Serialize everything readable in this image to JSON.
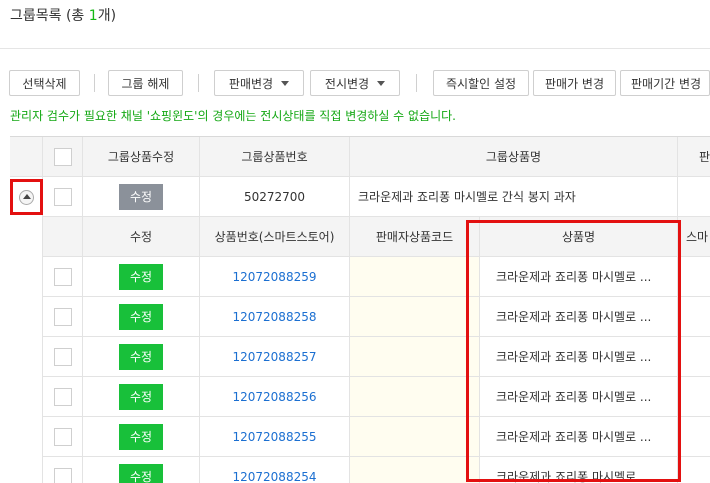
{
  "header": {
    "title_prefix": "그룹목록 (총 ",
    "count": "1",
    "title_suffix": "개)"
  },
  "toolbar": {
    "select_delete": "선택삭제",
    "ungroup": "그룹 해제",
    "sale_change": "판매변경",
    "display_change": "전시변경",
    "instant_discount": "즉시할인 설정",
    "price_change": "판매가 변경",
    "period_change": "판매기간 변경"
  },
  "notice": "관리자 검수가 필요한 채널 '쇼핑윈도'의 경우에는 전시상태를 직접 변경하실 수 없습니다.",
  "group_table": {
    "headers": [
      "그룹상품수정",
      "그룹상품번호",
      "그룹상품명",
      "판"
    ],
    "row": {
      "edit_label": "수정",
      "group_no": "50272700",
      "group_name": "크라운제과 죠리퐁 마시멜로 간식 봉지 과자"
    }
  },
  "sub_table": {
    "headers": [
      "수정",
      "상품번호(스마트스토어)",
      "판매자상품코드",
      "상품명",
      "스마"
    ],
    "edit_label": "수정",
    "rows": [
      {
        "product_no": "12072088259",
        "product_name": "크라운제과 죠리퐁 마시멜로 ..."
      },
      {
        "product_no": "12072088258",
        "product_name": "크라운제과 죠리퐁 마시멜로 ..."
      },
      {
        "product_no": "12072088257",
        "product_name": "크라운제과 죠리퐁 마시멜로 ..."
      },
      {
        "product_no": "12072088256",
        "product_name": "크라운제과 죠리퐁 마시멜로 ..."
      },
      {
        "product_no": "12072088255",
        "product_name": "크라운제과 죠리퐁 마시멜로 ..."
      },
      {
        "product_no": "12072088254",
        "product_name": "크라운제과 죠리퐁 마시멜로 ..."
      }
    ]
  },
  "icons": {
    "expand": "collapse-arrow-icon",
    "dropdown": "caret-down-icon"
  },
  "colors": {
    "accent_green": "#18c03a",
    "link_blue": "#1b6fd1",
    "highlight_red": "#e31010",
    "gray_button": "#8b919a"
  }
}
